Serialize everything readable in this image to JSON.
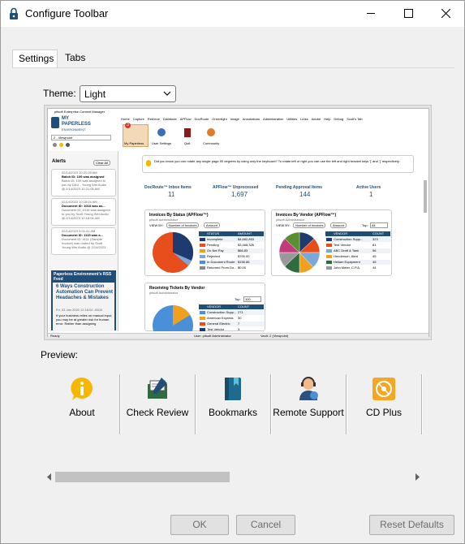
{
  "window": {
    "title": "Configure Toolbar"
  },
  "tabs": [
    {
      "label": "Settings"
    },
    {
      "label": "Tabs"
    }
  ],
  "theme": {
    "label": "Theme:",
    "value": "Light"
  },
  "preview": {
    "app_title": "pitsoft Enterprise Content Manager",
    "brand_line1": "MY",
    "brand_line2": "PAPERLESS",
    "brand_line3": "ENVIRONMENT",
    "viewpoint": "2 - Viewpoint",
    "menu": [
      "Home",
      "Capture",
      "Retrieve",
      "Distribute",
      "APFlow",
      "DocRoute",
      "Greenlight",
      "Image",
      "Annotations",
      "Administration",
      "Utilities",
      "Links",
      "Adobe",
      "Help",
      "Debug",
      "Scott's Tab"
    ],
    "ribbon": [
      "My Paperless",
      "User Settings",
      "Quit",
      "Community"
    ],
    "alerts_title": "Alerts",
    "clear_all": "Clear All",
    "alerts": [
      {
        "l1": "02/14/2023 10:21:05 AM",
        "l2": "Batch ID: 109 was assigned",
        "l3": "Batch ID: 109 was assigned to",
        "l4": "you by DAU - Young Wei Audio",
        "l5": "@ 2/14/2023 10:21:05 AM"
      },
      {
        "l1": "02/14/2023 10:18:04 AM",
        "l2": "Document ID: 1018 was as...",
        "l3": "Document ID: 1018 was assigned",
        "l4": "to you by Scott Young Wei Audio",
        "l5": "@ 2/14/2023 10:18:04 AM"
      },
      {
        "l1": "02/14/2023 9:01:41 AM",
        "l2": "Document ID: 1115 was a...",
        "l3": "Document ID: 4111 (Sample",
        "l4": "Invoice) was routed by Scott",
        "l5": "Young Wei Audio @ 2/14/2023"
      }
    ],
    "tip": "Did you know you can rotate any single page 90 degrees by using only the keyboard? To rotate left or right you can use the left and right bracket keys '[' and ']' respectively.",
    "stats": [
      {
        "label": "DocRoute™ Inbox Items",
        "value": "11"
      },
      {
        "label": "APFlow™ Unprocessed",
        "value": "1,697"
      },
      {
        "label": "Pending Approval Items",
        "value": "144"
      },
      {
        "label": "Active Users",
        "value": "1"
      }
    ],
    "panel1": {
      "title": "Invoices By Status (APFlow™)",
      "sub": "pitsoft Administrator",
      "viewby": "VIEW BY:",
      "opt1": "Number of Invoices",
      "opt2": "Amount",
      "col1": "STATUS",
      "col2": "AMOUNT",
      "rows": [
        [
          "Incomplete",
          "$4,682,853"
        ],
        [
          "Pending",
          "$3,468,326"
        ],
        [
          "On Net Pay",
          "$66.83"
        ],
        [
          "Rejected",
          "$700.00"
        ],
        [
          "In Document Route",
          "$156.86"
        ],
        [
          "Returned From Do...",
          "$0.00"
        ]
      ]
    },
    "panel2": {
      "title": "Invoices By Vendor (APFlow™)",
      "sub": "pitsoft Administrator",
      "viewby": "VIEW BY:",
      "opt1": "Number of Invoices",
      "opt2": "Amount",
      "top": "Top:",
      "top_val": "All",
      "col1": "VENDOR",
      "col2": "COUNT",
      "rows": [
        [
          "Construction Supp...",
          "323"
        ],
        [
          "Test Vendor",
          "81"
        ],
        [
          "ABC Draft & Tank",
          "56"
        ],
        [
          "Henderson, Alexi",
          "45"
        ],
        [
          "Hellam Equipment",
          "45"
        ],
        [
          "John Meter, C.P.A.",
          "44"
        ]
      ]
    },
    "panel3": {
      "title": "Receiving Tickets By Vendor",
      "sub": "pitsoft Administrator",
      "top": "Top:",
      "top_val": "100",
      "col1": "VENDOR",
      "col2": "COUNT",
      "rows": [
        [
          "Construction Supp...",
          "271"
        ],
        [
          "American Express",
          "30"
        ],
        [
          "General Electric",
          "7"
        ],
        [
          "Test Vendor",
          "3"
        ]
      ]
    },
    "rss": {
      "title": "Paperless Environment's RSS Feed",
      "headline": "6 Ways Construction Automation Can Prevent Headaches & Mistakes",
      "date": "Fri, 03 Jan 2020 12:18:00 -0500",
      "body": "If your business relies on manual input, you may be at greater risk for human error. Rather than assigning"
    },
    "status_ready": "Ready",
    "status_user": "User: pitsoft Administrator",
    "status_vault": "Vault: 2 (Viewpoint)",
    "badge": "3"
  },
  "preview_label": "Preview:",
  "toolbar_items": [
    {
      "label": "About",
      "icon": "info-icon"
    },
    {
      "label": "Check Review",
      "icon": "check-review-icon"
    },
    {
      "label": "Bookmarks",
      "icon": "bookmarks-icon"
    },
    {
      "label": "Remote Support",
      "icon": "remote-support-icon"
    },
    {
      "label": "CD Plus",
      "icon": "cd-plus-icon"
    }
  ],
  "buttons": {
    "ok": "OK",
    "cancel": "Cancel",
    "reset": "Reset Defaults"
  },
  "colors": {
    "accent_blue": "#1f4e79",
    "pie_orange": "#e84e1b",
    "pie_navy": "#1e3a6e",
    "blue": "#4a90d9",
    "gold": "#f5b700"
  }
}
